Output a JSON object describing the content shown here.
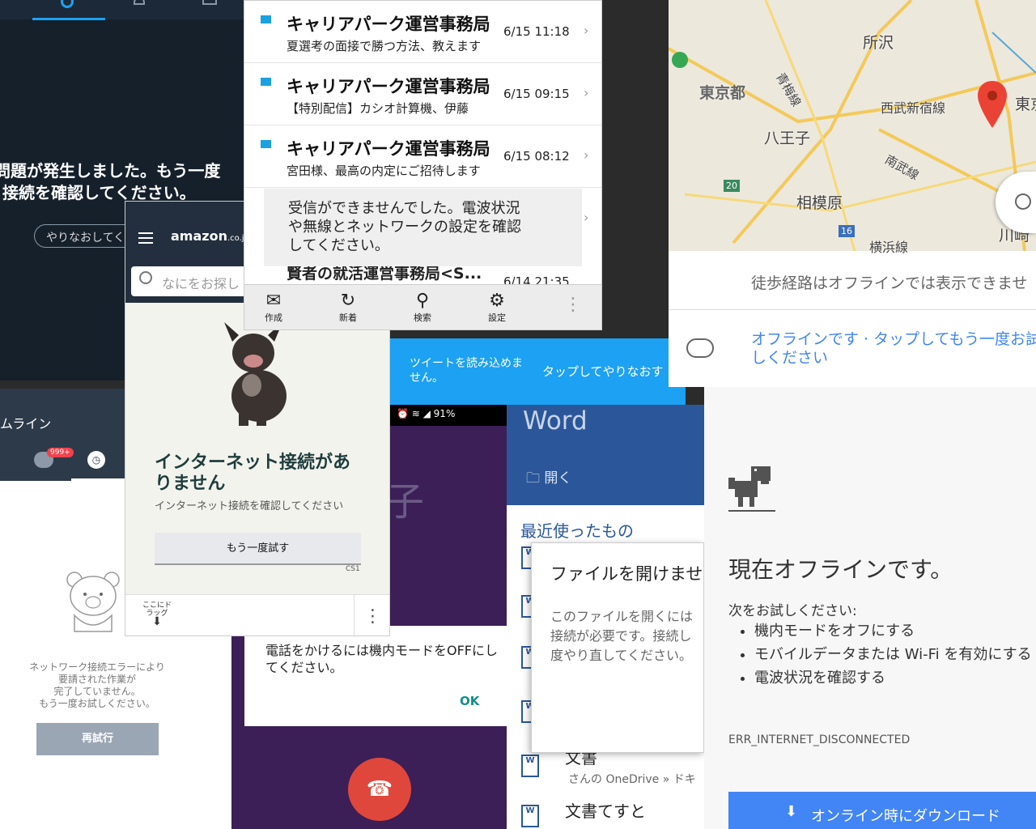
{
  "twitter_dark": {
    "error_line1": "問題が発生しました。もう一度",
    "error_line2": "接続を確認してください。",
    "retry": "やりなおしてく"
  },
  "line": {
    "title": "ムライン",
    "badge": "999+",
    "error_lines": [
      "ネットワーク接続エラーにより",
      "要請された作業が",
      "完了していません。",
      "もう一度お試しください。"
    ],
    "retry": "再試行"
  },
  "amazon": {
    "logo": "amazon",
    "logo_suffix": ".co.jp",
    "search_placeholder": "なにをお探し",
    "heading": "インターネット接続がありません",
    "sub": "インターネット接続を確認してください",
    "retry": "もう一度試す",
    "code": "CS1",
    "drag": "ここにドラッグ"
  },
  "mail": {
    "rows": [
      {
        "sender": "キャリアパーク運営事務局",
        "subject": "夏選考の面接で勝つ方法、教えます",
        "time": "6/15 11:18"
      },
      {
        "sender": "キャリアパーク運営事務局",
        "subject": "【特別配信】カシオ計算機、伊藤",
        "time": "6/15 09:15"
      },
      {
        "sender": "キャリアパーク運営事務局",
        "subject": "宮田様、最高の内定にご招待します",
        "time": "6/15 08:12"
      }
    ],
    "toast_lines": [
      "受信ができませんでした。電波状況",
      "や無線とネットワークの設定を確認",
      "してください。"
    ],
    "peek_sender": "賢者の就活運営事務局<S...",
    "peek_time": "6/14 21:35",
    "toolbar": {
      "compose": "作成",
      "refresh": "新着",
      "search": "検索",
      "settings": "設定"
    }
  },
  "twitter_blue": {
    "cant_load": "ツイートを読み込めません。",
    "tap_retry": "タップしてやりなおす"
  },
  "phone": {
    "battery": "91%",
    "big_char": "子",
    "dialog": "電話をかけるには機内モードをOFFにしてください。",
    "ok": "OK"
  },
  "word": {
    "title": "Word",
    "open": "開く",
    "recent": "最近使ったもの",
    "dialog_title": "ファイルを開けませ",
    "dialog_lines": [
      "このファイルを開くには",
      "接続が必要です。接続し",
      "度やり直してください。"
    ],
    "doc1": "文書",
    "doc_path": "さんの OneDrive » ドキ",
    "doc2": "文書てすと"
  },
  "maps": {
    "labels": {
      "tokyo": "東京都",
      "tokorozawa": "所沢",
      "ome": "青梅線",
      "seibu": "西武新宿線",
      "hachioji": "八王子",
      "nambu": "南武線",
      "sagamihara": "相模原",
      "yokohama": "横浜線",
      "tokyo_right": "東京",
      "kawasaki": "川崎",
      "r20": "20",
      "r16": "16"
    },
    "walk_note": "徒歩経路はオフラインでは表示できませ",
    "offline_msg": "オフラインです · タップしてもう一度お試しください"
  },
  "chrome": {
    "heading": "現在オフラインです。",
    "try": "次をお試しください:",
    "tips": [
      "機内モードをオフにする",
      "モバイルデータまたは Wi-Fi を有効にする",
      "電波状況を確認する"
    ],
    "code": "ERR_INTERNET_DISCONNECTED",
    "download": "オンライン時にダウンロード"
  },
  "colors": {
    "twitter_blue": "#1da1f2",
    "word_blue": "#2b579a",
    "chrome_blue": "#4285f4",
    "line_dark": "#2d3a4a",
    "amazon_dark": "#232f3e"
  }
}
